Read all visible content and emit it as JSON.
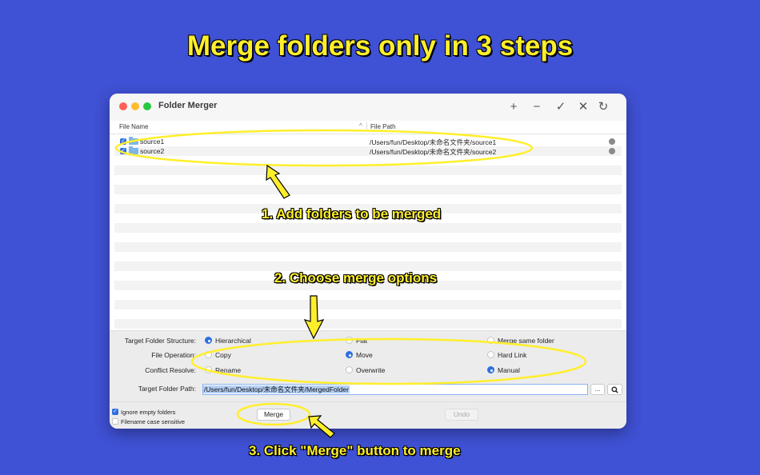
{
  "headline": "Merge folders only in 3 steps",
  "window": {
    "title": "Folder Merger",
    "toolbar": {
      "add": "+",
      "remove": "−",
      "check": "✓",
      "close": "✕",
      "refresh": "↻"
    }
  },
  "table": {
    "col_file_name": "File Name",
    "col_file_path": "File Path",
    "sort_indicator": "^",
    "rows": [
      {
        "name": "source1",
        "path": "/Users/fun/Desktop/未命名文件夹/source1",
        "checked": true
      },
      {
        "name": "source2",
        "path": "/Users/fun/Desktop/未命名文件夹/source2",
        "checked": true
      }
    ]
  },
  "options": {
    "structure": {
      "label": "Target Folder Structure:",
      "choices": [
        "Hierarchical",
        "Flat",
        "Merge same folder"
      ],
      "selected": "Hierarchical"
    },
    "operation": {
      "label": "File Operation:",
      "choices": [
        "Copy",
        "Move",
        "Hard Link"
      ],
      "selected": "Move"
    },
    "conflict": {
      "label": "Conflict Resolve:",
      "choices": [
        "Rename",
        "Overwrite",
        "Manual"
      ],
      "selected": "Manual"
    },
    "target_path": {
      "label": "Target Folder Path:",
      "value": "/Users/fun/Desktop/未命名文件夹/MergedFolder",
      "browse": "...",
      "reveal_icon": "search-icon"
    }
  },
  "footer": {
    "ignore_empty": {
      "label": "Ignore empty folders",
      "checked": true
    },
    "case_sensitive": {
      "label": "Filename case sensitive",
      "checked": false
    },
    "merge_button": "Merge",
    "undo_button": "Undo"
  },
  "callouts": {
    "step1": "1. Add folders to be merged",
    "step2": "2. Choose merge options",
    "step3": "3. Click \"Merge\" button to merge"
  },
  "colors": {
    "background": "#3f51d4",
    "highlight": "#ffef2b",
    "accent": "#2f6fe0"
  }
}
